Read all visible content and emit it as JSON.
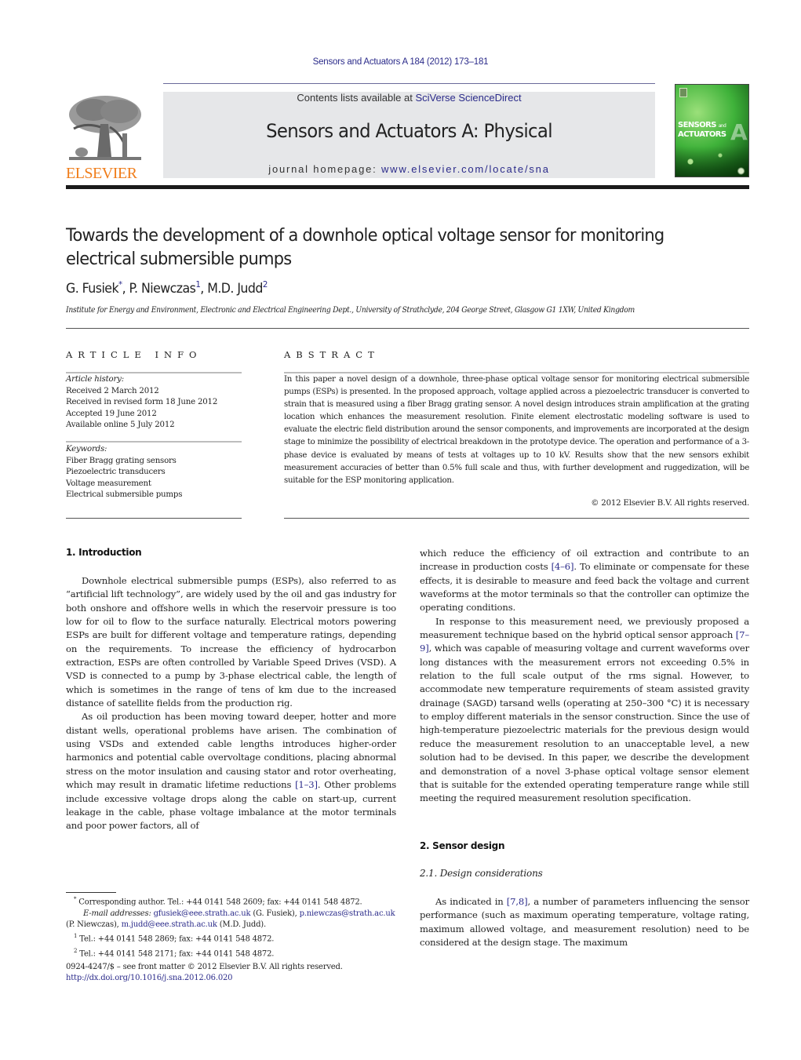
{
  "header": {
    "citation": "Sensors and Actuators A 184 (2012) 173–181",
    "contents_prefix": "Contents lists available at ",
    "contents_link": "SciVerse ScienceDirect",
    "journal_title": "Sensors and Actuators A: Physical",
    "homepage_prefix": "journal homepage: ",
    "homepage_link": "www.elsevier.com/locate/sna",
    "publisher_logo_text": "ELSEVIER",
    "cover": {
      "line1": "SENSORS",
      "and": "and",
      "line2": "ACTUATORS",
      "letter": "A"
    }
  },
  "article": {
    "title": "Towards the development of a downhole optical voltage sensor for monitoring electrical submersible pumps",
    "authors": [
      {
        "name": "G. Fusiek",
        "mark": "*"
      },
      {
        "name": "P. Niewczas",
        "mark": "1"
      },
      {
        "name": "M.D. Judd",
        "mark": "2"
      }
    ],
    "affiliation": "Institute for Energy and Environment, Electronic and Electrical Engineering Dept., University of Strathclyde, 204 George Street, Glasgow G1 1XW, United Kingdom"
  },
  "article_info": {
    "heading": "ARTICLE INFO",
    "history_label": "Article history:",
    "history": [
      "Received 2 March 2012",
      "Received in revised form 18 June 2012",
      "Accepted 19 June 2012",
      "Available online 5 July 2012"
    ],
    "keywords_label": "Keywords:",
    "keywords": [
      "Fiber Bragg grating sensors",
      "Piezoelectric transducers",
      "Voltage measurement",
      "Electrical submersible pumps"
    ]
  },
  "abstract": {
    "heading": "ABSTRACT",
    "text": "In this paper a novel design of a downhole, three-phase optical voltage sensor for monitoring electrical submersible pumps (ESPs) is presented. In the proposed approach, voltage applied across a piezoelectric transducer is converted to strain that is measured using a fiber Bragg grating sensor. A novel design introduces strain amplification at the grating location which enhances the measurement resolution. Finite element electrostatic modeling software is used to evaluate the electric field distribution around the sensor components, and improvements are incorporated at the design stage to minimize the possibility of electrical breakdown in the prototype device. The operation and performance of a 3-phase device is evaluated by means of tests at voltages up to 10 kV. Results show that the new sensors exhibit measurement accuracies of better than 0.5% full scale and thus, with further development and ruggedization, will be suitable for the ESP monitoring application.",
    "copyright": "© 2012 Elsevier B.V. All rights reserved."
  },
  "body": {
    "intro_heading": "1.  Introduction",
    "intro_p1": "Downhole electrical submersible pumps (ESPs), also referred to as “artificial lift technology”, are widely used by the oil and gas industry for both onshore and offshore wells in which the reservoir pressure is too low for oil to flow to the surface naturally. Electrical motors powering ESPs are built for different voltage and temperature ratings, depending on the requirements. To increase the efficiency of hydrocarbon extraction, ESPs are often controlled by Variable Speed Drives (VSD). A VSD is connected to a pump by 3-phase electrical cable, the length of which is sometimes in the range of tens of km due to the increased distance of satellite fields from the production rig.",
    "intro_p2_a": "As oil production has been moving toward deeper, hotter and more distant wells, operational problems have arisen. The combination of using VSDs and extended cable lengths introduces higher-order harmonics and potential cable overvoltage conditions, placing abnormal stress on the motor insulation and causing stator and rotor overheating, which may result in dramatic lifetime reductions ",
    "ref_1_3": "[1–3]",
    "intro_p2_b": ". Other problems include excessive voltage drops along the cable on start-up, current leakage in the cable, phase voltage imbalance at the motor terminals and poor power factors, all of",
    "right_p1_a": "which reduce the efficiency of oil extraction and contribute to an increase in production costs ",
    "ref_4_6": "[4–6]",
    "right_p1_b": ". To eliminate or compensate for these effects, it is desirable to measure and feed back the voltage and current waveforms at the motor terminals so that the controller can optimize the operating conditions.",
    "right_p2_a": "In response to this measurement need, we previously proposed a measurement technique based on the hybrid optical sensor approach ",
    "ref_7_9": "[7–9]",
    "right_p2_b": ", which was capable of measuring voltage and current waveforms over long distances with the measurement errors not exceeding 0.5% in relation to the full scale output of the rms signal. However, to accommodate new temperature requirements of steam assisted gravity drainage (SAGD) tarsand wells (operating at 250–300 °C) it is necessary to employ different materials in the sensor construction. Since the use of high-temperature piezoelectric materials for the previous design would reduce the measurement resolution to an unacceptable level, a new solution had to be devised. In this paper, we describe the development and demonstration of a novel 3-phase optical voltage sensor element that is suitable for the extended operating temperature range while still meeting the required measurement resolution specification.",
    "s2_heading": "2.  Sensor design",
    "s21_heading": "2.1.  Design considerations",
    "s21_p1_a": "As indicated in ",
    "ref_7_8": "[7,8]",
    "s21_p1_b": ", a number of parameters influencing the sensor performance (such as maximum operating temperature, voltage rating, maximum allowed voltage, and measurement resolution) need to be considered at the design stage. The maximum"
  },
  "footnotes": {
    "corr_mark": "*",
    "corr": " Corresponding author. Tel.: +44 0141 548 2609; fax: +44 0141 548 4872.",
    "email_label": "E-mail addresses: ",
    "email1": "gfusiek@eee.strath.ac.uk",
    "email1_owner": " (G. Fusiek), ",
    "email2": "p.niewczas@strath.ac.uk",
    "email2_owner": " (P. Niewczas), ",
    "email3": "m.judd@eee.strath.ac.uk",
    "email3_owner": " (M.D. Judd).",
    "fn1_mark": "1",
    "fn1": " Tel.: +44 0141 548 2869; fax: +44 0141 548 4872.",
    "fn2_mark": "2",
    "fn2": " Tel.: +44 0141 548 2171; fax: +44 0141 548 4872.",
    "front_matter": "0924-4247/$ – see front matter © 2012 Elsevier B.V. All rights reserved.",
    "doi": "http://dx.doi.org/10.1016/j.sna.2012.06.020"
  },
  "colors": {
    "link": "#2b2b8a",
    "elsevier_orange": "#f07d1a",
    "banner_grey": "#e6e7e9",
    "cover_green": "#3fb23a"
  }
}
